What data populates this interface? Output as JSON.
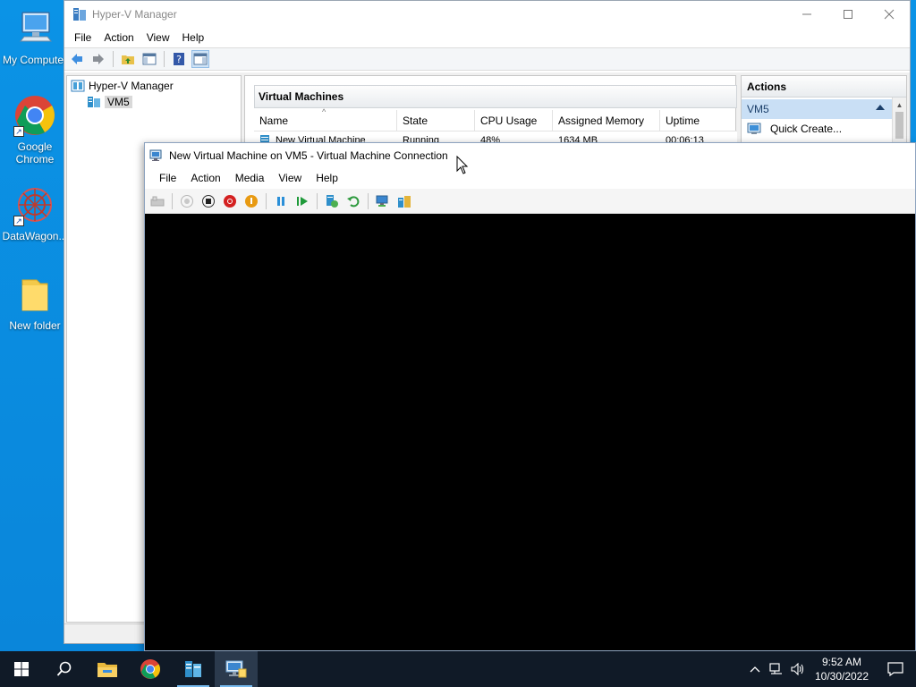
{
  "desktop": {
    "icons": [
      {
        "label": "My Computer"
      },
      {
        "label": "Google Chrome"
      },
      {
        "label": "DataWagon..."
      },
      {
        "label": "New folder"
      }
    ]
  },
  "hyperv": {
    "title": "Hyper-V Manager",
    "menu": [
      "File",
      "Action",
      "View",
      "Help"
    ],
    "tree": {
      "root": "Hyper-V Manager",
      "server": "VM5"
    },
    "vm_panel": {
      "header": "Virtual Machines",
      "columns": [
        "Name",
        "State",
        "CPU Usage",
        "Assigned Memory",
        "Uptime"
      ],
      "rows": [
        {
          "name": "New Virtual Machine",
          "state": "Running",
          "cpu": "48%",
          "memory": "1634 MB",
          "uptime": "00:06:13"
        }
      ]
    },
    "actions": {
      "header": "Actions",
      "section": "VM5",
      "items": [
        "Quick Create..."
      ]
    }
  },
  "vmconnect": {
    "title": "New Virtual Machine on VM5 - Virtual Machine Connection",
    "menu": [
      "File",
      "Action",
      "Media",
      "View",
      "Help"
    ]
  },
  "taskbar": {
    "time": "9:52 AM",
    "date": "10/30/2022"
  },
  "colors": {
    "desktop": "#0a8ce0",
    "taskbar": "#101a27",
    "accent": "#76b9ed",
    "selection": "#c9dff5"
  }
}
